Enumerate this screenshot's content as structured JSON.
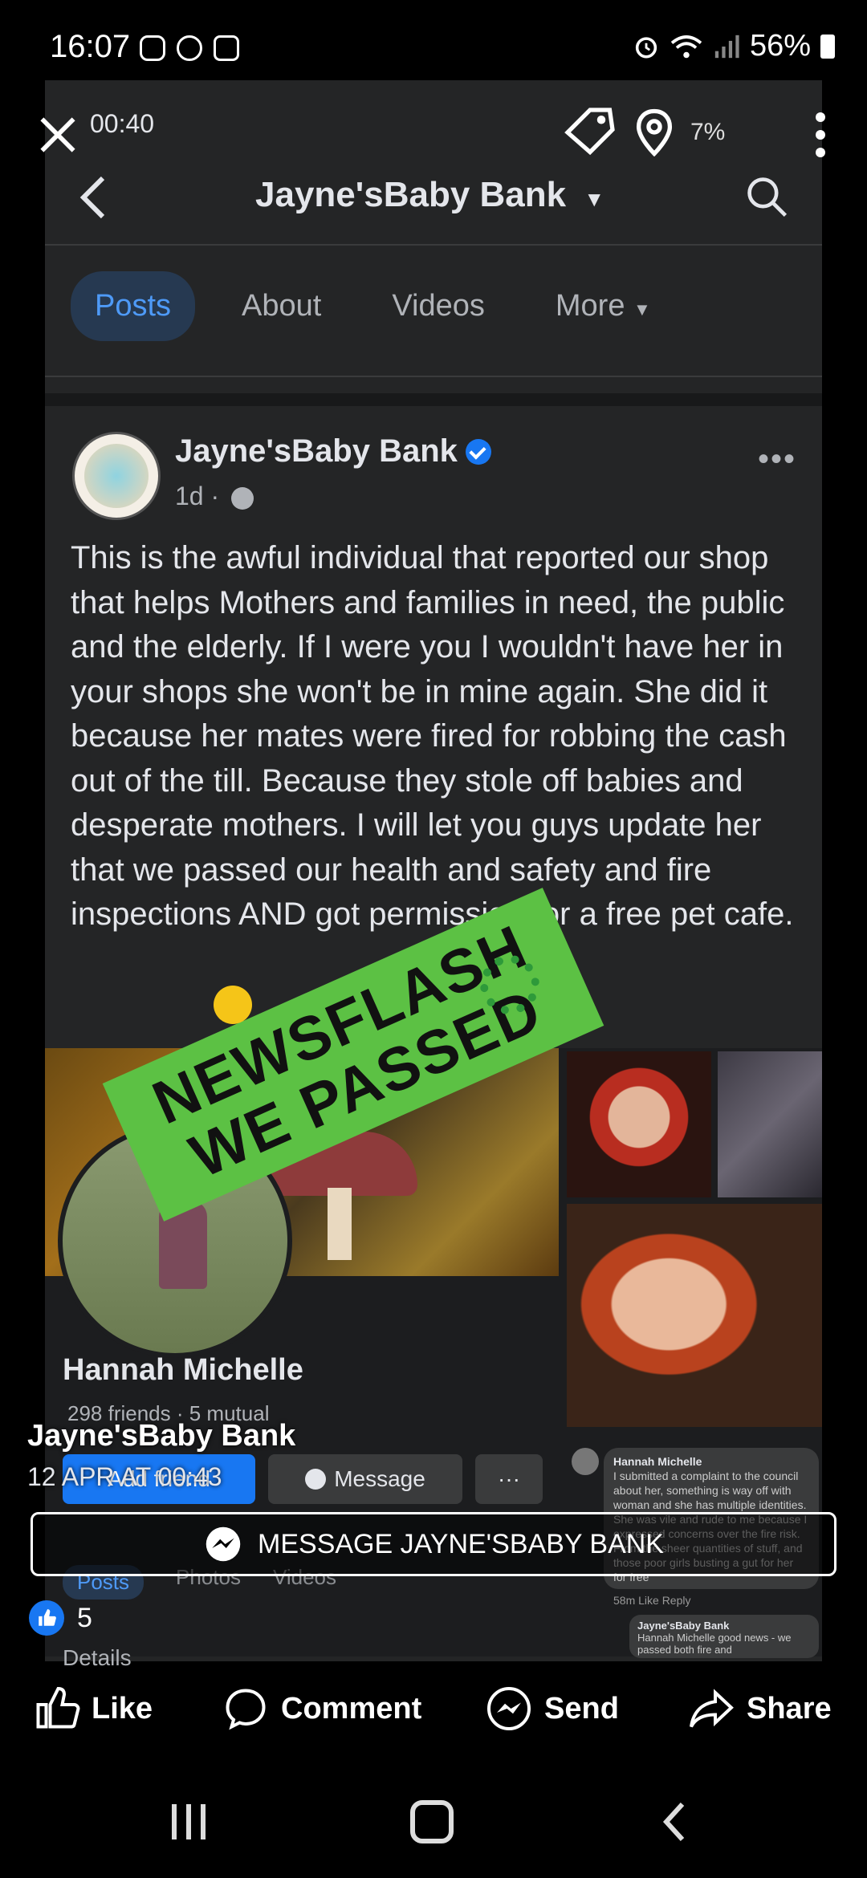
{
  "status_bar": {
    "time": "16:07",
    "battery": "56%"
  },
  "video_overlay": {
    "mini_time": "00:40",
    "mini_battery": "7%"
  },
  "page_header": {
    "title": "Jayne'sBaby Bank"
  },
  "tabs": [
    {
      "label": "Posts",
      "active": true
    },
    {
      "label": "About"
    },
    {
      "label": "Videos"
    },
    {
      "label": "More"
    }
  ],
  "post": {
    "author": "Jayne'sBaby Bank",
    "meta": "1d ·",
    "text": "This is the awful individual that reported our shop that helps Mothers and families in need, the public and the elderly.  If I were you I wouldn't have her in your shops she won't be in mine again. She did it because her mates were fired for robbing the cash out of the till. Because they stole off babies and desperate mothers. I will let you guys update her that we passed our health and safety and fire inspections AND got permission for a free pet cafe.",
    "banner_line1": "NEWSFLASH",
    "banner_line2": "WE PASSED"
  },
  "screenshot_profile": {
    "name": "Hannah Michelle",
    "friends": "298 friends · 5 mutual",
    "add_friend": "Add friend",
    "message": "Message",
    "more": "···",
    "subtabs": [
      "Posts",
      "Photos",
      "Videos"
    ],
    "details": "Details",
    "comment_author": "Hannah Michelle",
    "comment_text": "I submitted a complaint to the council about her, something is way off with woman and she has multiple identities. She was vile and rude to me because I expressed concerns over the fire risk. From the sheer quantities of stuff, and those poor girls busting a gut for her for free",
    "comment_meta": "58m   Like   Reply",
    "reply_author": "Jayne'sBaby Bank",
    "reply_text": "Hannah Michelle good news - we passed both fire and"
  },
  "overlay": {
    "page_name": "Jayne'sBaby Bank",
    "date": "12 APR AT 00:43",
    "cta": "MESSAGE JAYNE'SBABY BANK",
    "like_count": "5"
  },
  "actions": {
    "like": "Like",
    "comment": "Comment",
    "send": "Send",
    "share": "Share"
  },
  "colors": {
    "accent": "#1877f2",
    "banner_green": "#5cc144",
    "card_bg": "#242526"
  }
}
